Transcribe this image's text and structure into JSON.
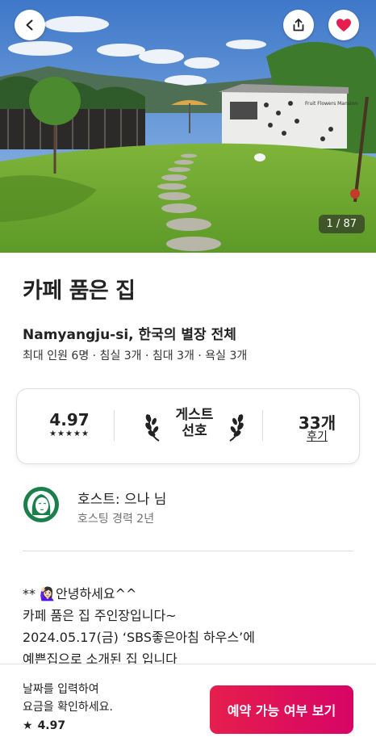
{
  "hero": {
    "photo_counter": "1 / 87",
    "sign_text": "Fruit Flowers Mansion"
  },
  "listing": {
    "title": "카페 품은 집",
    "subtitle": "Namyangju-si, 한국의 별장 전체",
    "specs": "최대 인원 6명 · 침실 3개 · 침대 3개 · 욕실 3개"
  },
  "rating_card": {
    "score": "4.97",
    "stars": "★★★★★",
    "guest_fav_line1": "게스트",
    "guest_fav_line2": "선호",
    "review_count": "33개",
    "review_label": "후기"
  },
  "host": {
    "name": "호스트: 으나 님",
    "experience": "호스팅 경력 2년"
  },
  "description": {
    "line1": "** 🙋🏻‍♀️안녕하세요^^",
    "line2": "카페 품은 집 주인장입니다~",
    "line3": "2024.05.17(금) ‘SBS좋은아침 하우스’에",
    "line4": "예쁜집으로 소개된 집 입니다"
  },
  "bottom_bar": {
    "line1": "날짜를 입력하여",
    "line2": "요금을 확인하세요.",
    "rating": "4.97",
    "star": "★",
    "cta_label": "예약 가능 여부 보기"
  },
  "colors": {
    "accent": "#E61E4D",
    "wishlist_heart": "#E61E4D",
    "host_logo": "#1A7F4B"
  },
  "icons": [
    "chevron-left-icon",
    "share-icon",
    "heart-icon",
    "laurel-left-icon",
    "laurel-right-icon",
    "star-icon"
  ]
}
